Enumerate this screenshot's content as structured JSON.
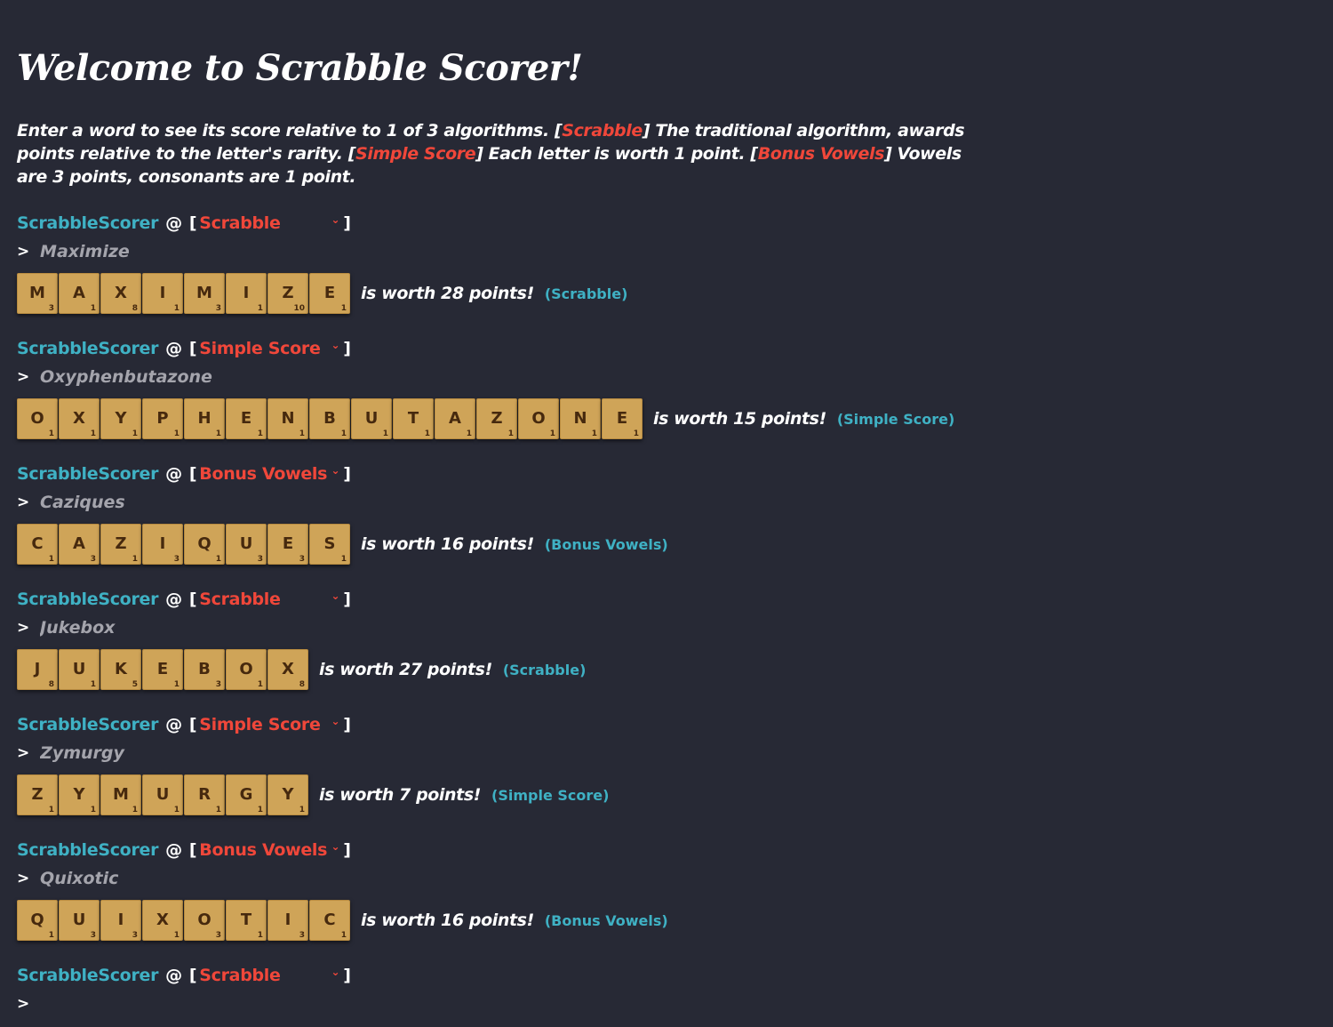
{
  "title": "Welcome to Scrabble Scorer!",
  "intro": {
    "part1": "Enter a word to see its score relative to 1 of 3 algorithms. [",
    "algo1": "Scrabble",
    "part2": "] The traditional algorithm, awards points relative to the letter's rarity. [",
    "algo2": "Simple Score",
    "part3": "] Each letter is worth 1 point. [",
    "algo3": "Bonus Vowels",
    "part4": "] Vowels are 3 points, consonants are 1 point."
  },
  "prompt": {
    "name": "ScrabbleScorer",
    "at": "@",
    "open_bracket": "[",
    "close_bracket": "]",
    "caret": ">",
    "chevron": "⌄"
  },
  "colors": {
    "background": "#272935",
    "accent_cyan": "#3fb1c4",
    "accent_red": "#f0473a",
    "tile": "#cfa458",
    "tile_text": "#46290e"
  },
  "entries": [
    {
      "algorithm": "Scrabble",
      "word": "Maximize",
      "tiles": [
        {
          "letter": "M",
          "points": "3"
        },
        {
          "letter": "A",
          "points": "1"
        },
        {
          "letter": "X",
          "points": "8"
        },
        {
          "letter": "I",
          "points": "1"
        },
        {
          "letter": "M",
          "points": "3"
        },
        {
          "letter": "I",
          "points": "1"
        },
        {
          "letter": "Z",
          "points": "10"
        },
        {
          "letter": "E",
          "points": "1"
        }
      ],
      "result": "is worth 28 points!",
      "tag": "(Scrabble)"
    },
    {
      "algorithm": "Simple Score",
      "word": "Oxyphenbutazone",
      "tiles": [
        {
          "letter": "O",
          "points": "1"
        },
        {
          "letter": "X",
          "points": "1"
        },
        {
          "letter": "Y",
          "points": "1"
        },
        {
          "letter": "P",
          "points": "1"
        },
        {
          "letter": "H",
          "points": "1"
        },
        {
          "letter": "E",
          "points": "1"
        },
        {
          "letter": "N",
          "points": "1"
        },
        {
          "letter": "B",
          "points": "1"
        },
        {
          "letter": "U",
          "points": "1"
        },
        {
          "letter": "T",
          "points": "1"
        },
        {
          "letter": "A",
          "points": "1"
        },
        {
          "letter": "Z",
          "points": "1"
        },
        {
          "letter": "O",
          "points": "1"
        },
        {
          "letter": "N",
          "points": "1"
        },
        {
          "letter": "E",
          "points": "1"
        }
      ],
      "result": "is worth 15 points!",
      "tag": "(Simple Score)"
    },
    {
      "algorithm": "Bonus Vowels",
      "word": "Caziques",
      "tiles": [
        {
          "letter": "C",
          "points": "1"
        },
        {
          "letter": "A",
          "points": "3"
        },
        {
          "letter": "Z",
          "points": "1"
        },
        {
          "letter": "I",
          "points": "3"
        },
        {
          "letter": "Q",
          "points": "1"
        },
        {
          "letter": "U",
          "points": "3"
        },
        {
          "letter": "E",
          "points": "3"
        },
        {
          "letter": "S",
          "points": "1"
        }
      ],
      "result": "is worth 16 points!",
      "tag": "(Bonus Vowels)"
    },
    {
      "algorithm": "Scrabble",
      "word": "Jukebox",
      "tiles": [
        {
          "letter": "J",
          "points": "8"
        },
        {
          "letter": "U",
          "points": "1"
        },
        {
          "letter": "K",
          "points": "5"
        },
        {
          "letter": "E",
          "points": "1"
        },
        {
          "letter": "B",
          "points": "3"
        },
        {
          "letter": "O",
          "points": "1"
        },
        {
          "letter": "X",
          "points": "8"
        }
      ],
      "result": "is worth 27 points!",
      "tag": "(Scrabble)"
    },
    {
      "algorithm": "Simple Score",
      "word": "Zymurgy",
      "tiles": [
        {
          "letter": "Z",
          "points": "1"
        },
        {
          "letter": "Y",
          "points": "1"
        },
        {
          "letter": "M",
          "points": "1"
        },
        {
          "letter": "U",
          "points": "1"
        },
        {
          "letter": "R",
          "points": "1"
        },
        {
          "letter": "G",
          "points": "1"
        },
        {
          "letter": "Y",
          "points": "1"
        }
      ],
      "result": "is worth 7 points!",
      "tag": "(Simple Score)"
    },
    {
      "algorithm": "Bonus Vowels",
      "word": "Quixotic",
      "tiles": [
        {
          "letter": "Q",
          "points": "1"
        },
        {
          "letter": "U",
          "points": "3"
        },
        {
          "letter": "I",
          "points": "3"
        },
        {
          "letter": "X",
          "points": "1"
        },
        {
          "letter": "O",
          "points": "3"
        },
        {
          "letter": "T",
          "points": "1"
        },
        {
          "letter": "I",
          "points": "3"
        },
        {
          "letter": "C",
          "points": "1"
        }
      ],
      "result": "is worth 16 points!",
      "tag": "(Bonus Vowels)"
    }
  ],
  "pending": {
    "algorithm": "Scrabble",
    "word": ""
  }
}
